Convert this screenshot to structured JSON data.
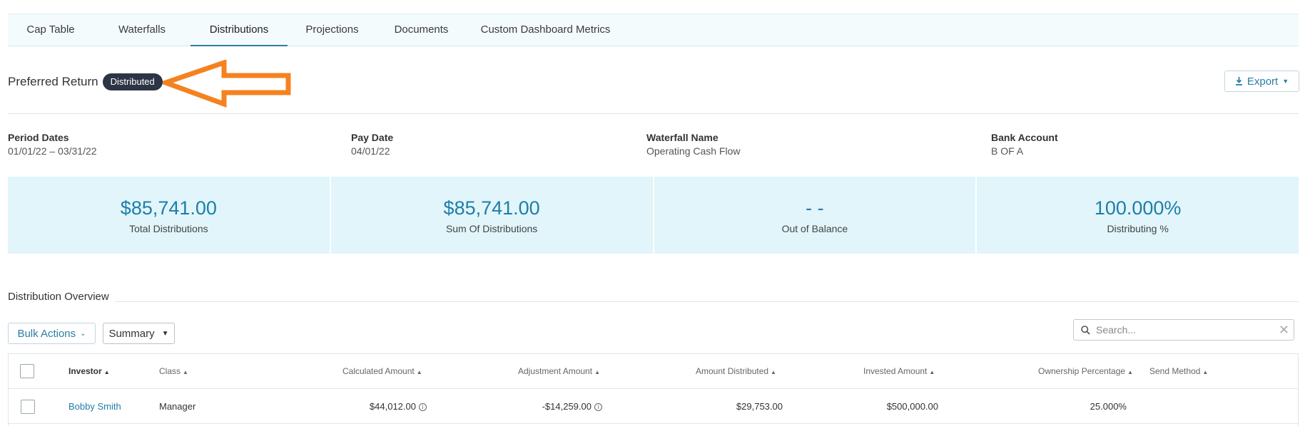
{
  "tabs": [
    "Cap Table",
    "Waterfalls",
    "Distributions",
    "Projections",
    "Documents",
    "Custom Dashboard Metrics"
  ],
  "header": {
    "title": "Preferred Return",
    "badge": "Distributed",
    "export_label": "Export"
  },
  "meta": {
    "period": {
      "label": "Period Dates",
      "value": "01/01/22 – 03/31/22"
    },
    "pay": {
      "label": "Pay Date",
      "value": "04/01/22"
    },
    "waterfall": {
      "label": "Waterfall Name",
      "value": "Operating Cash Flow"
    },
    "bank": {
      "label": "Bank Account",
      "value": "B OF A"
    }
  },
  "stats": [
    {
      "value": "$85,741.00",
      "label": "Total Distributions"
    },
    {
      "value": "$85,741.00",
      "label": "Sum Of Distributions"
    },
    {
      "value": "- -",
      "label": "Out of Balance"
    },
    {
      "value": "100.000%",
      "label": "Distributing %"
    }
  ],
  "overview": {
    "title": "Distribution Overview",
    "bulk_label": "Bulk Actions",
    "summary_label": "Summary",
    "search_placeholder": "Search..."
  },
  "table": {
    "columns": [
      "Investor",
      "Class",
      "Calculated Amount",
      "Adjustment Amount",
      "Amount Distributed",
      "Invested Amount",
      "Ownership Percentage",
      "Send Method"
    ],
    "rows": [
      {
        "investor": "Bobby Smith",
        "class": "Manager",
        "calculated": "$44,012.00",
        "adjustment": "-$14,259.00",
        "distributed": "$29,753.00",
        "invested": "$500,000.00",
        "ownership": "25.000%",
        "send_method": ""
      }
    ]
  },
  "colors": {
    "accent": "#1e7ea8",
    "badge_bg": "#2b3545",
    "stats_bg": "#e1f5fa",
    "arrow": "#f58220"
  },
  "icons": [
    "download-icon",
    "caret-down-icon",
    "search-icon",
    "clear-icon",
    "info-icon",
    "sort-up-icon",
    "arrow-annotation"
  ]
}
